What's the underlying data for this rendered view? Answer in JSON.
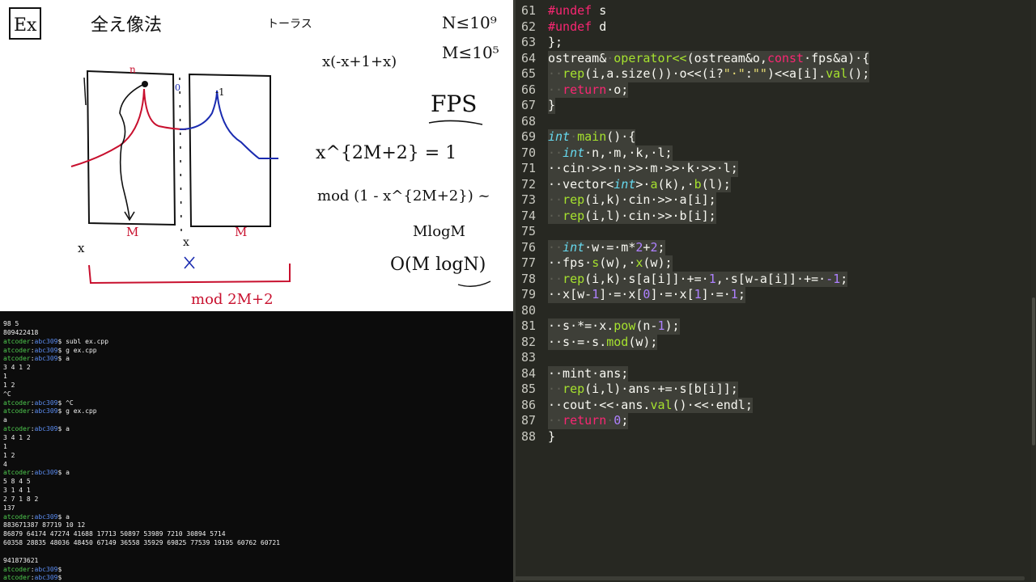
{
  "whiteboard": {
    "ex_label": "Ex",
    "title": "全え像法",
    "torus_note": "トーラス",
    "constraint_n": "N≤10⁹",
    "constraint_m": "M≤10⁵",
    "x_poly": "x(-x+1+x)",
    "fps": "FPS",
    "x_power": "x^{2M+2} = 1",
    "mod_expr": "mod (1 - x^{2M+2}) ~",
    "mlogm": "MlogM",
    "complexity": "O(M logN)",
    "top_mark": "n",
    "right_mark": "-1",
    "left_tick": "0",
    "x_label_left": "x",
    "m_label_left": "M",
    "x_label_mid": "x",
    "m_label_right": "M",
    "mod_bottom": "mod 2M+2"
  },
  "terminal": {
    "lines": [
      [
        [
          "98 5",
          ""
        ]
      ],
      [
        [
          "809422418",
          ""
        ]
      ],
      [
        [
          "atcoder",
          "u"
        ],
        [
          ":",
          ""
        ],
        [
          "abc309",
          "h"
        ],
        [
          "$ subl ex.cpp",
          ""
        ]
      ],
      [
        [
          "atcoder",
          "u"
        ],
        [
          ":",
          ""
        ],
        [
          "abc309",
          "h"
        ],
        [
          "$ g ex.cpp",
          ""
        ]
      ],
      [
        [
          "atcoder",
          "u"
        ],
        [
          ":",
          ""
        ],
        [
          "abc309",
          "h"
        ],
        [
          "$ a",
          ""
        ]
      ],
      [
        [
          "3 4 1 2",
          ""
        ]
      ],
      [
        [
          "1",
          ""
        ]
      ],
      [
        [
          "1 2",
          ""
        ]
      ],
      [
        [
          "^C",
          ""
        ]
      ],
      [
        [
          "atcoder",
          "u"
        ],
        [
          ":",
          ""
        ],
        [
          "abc309",
          "h"
        ],
        [
          "$ ^C",
          ""
        ]
      ],
      [
        [
          "atcoder",
          "u"
        ],
        [
          ":",
          ""
        ],
        [
          "abc309",
          "h"
        ],
        [
          "$ g ex.cpp",
          ""
        ]
      ],
      [
        [
          "a",
          ""
        ]
      ],
      [
        [
          "atcoder",
          "u"
        ],
        [
          ":",
          ""
        ],
        [
          "abc309",
          "h"
        ],
        [
          "$ a",
          ""
        ]
      ],
      [
        [
          "3 4 1 2",
          ""
        ]
      ],
      [
        [
          "1",
          ""
        ]
      ],
      [
        [
          "1 2",
          ""
        ]
      ],
      [
        [
          "4",
          ""
        ]
      ],
      [
        [
          "atcoder",
          "u"
        ],
        [
          ":",
          ""
        ],
        [
          "abc309",
          "h"
        ],
        [
          "$ a",
          ""
        ]
      ],
      [
        [
          "5 8 4 5",
          ""
        ]
      ],
      [
        [
          "3 1 4 1",
          ""
        ]
      ],
      [
        [
          "2 7 1 8 2",
          ""
        ]
      ],
      [
        [
          "137",
          ""
        ]
      ],
      [
        [
          "atcoder",
          "u"
        ],
        [
          ":",
          ""
        ],
        [
          "abc309",
          "h"
        ],
        [
          "$ a",
          ""
        ]
      ],
      [
        [
          "883671387 87719 10 12",
          ""
        ]
      ],
      [
        [
          "86879 64174 47274 41688 17713 50897 53989 7210 30894 5714",
          ""
        ]
      ],
      [
        [
          "60358 28835 48036 48450 67149 36558 35929 69825 77539 19195 60762 60721",
          ""
        ]
      ],
      [
        [
          "",
          ""
        ]
      ],
      [
        [
          "941873621",
          ""
        ]
      ],
      [
        [
          "atcoder",
          "u"
        ],
        [
          ":",
          ""
        ],
        [
          "abc309",
          "h"
        ],
        [
          "$",
          ""
        ]
      ],
      [
        [
          "atcoder",
          "u"
        ],
        [
          ":",
          ""
        ],
        [
          "abc309",
          "h"
        ],
        [
          "$",
          ""
        ]
      ]
    ]
  },
  "editor": {
    "lines": [
      {
        "n": "61",
        "sel": false,
        "t": [
          [
            "#undef",
            "kw"
          ],
          [
            " s",
            ""
          ]
        ]
      },
      {
        "n": "62",
        "sel": false,
        "t": [
          [
            "#undef",
            "kw"
          ],
          [
            " d",
            ""
          ]
        ]
      },
      {
        "n": "63",
        "sel": false,
        "t": [
          [
            "};",
            ""
          ]
        ]
      },
      {
        "n": "64",
        "sel": true,
        "t": [
          [
            "ostream&",
            ""
          ],
          [
            "·",
            "ws"
          ],
          [
            "operator<<",
            "fn"
          ],
          [
            "(ostream&o,",
            ""
          ],
          [
            "const",
            "kw"
          ],
          [
            "·fps&a)·{",
            ""
          ]
        ]
      },
      {
        "n": "65",
        "sel": true,
        "t": [
          [
            "··",
            "ws"
          ],
          [
            "rep",
            "fn"
          ],
          [
            "(i,a.size())·o<<(i?",
            ""
          ],
          [
            "\"·\"",
            "st"
          ],
          [
            ":",
            ""
          ],
          [
            "\"\"",
            "st"
          ],
          [
            ")<<a[i].",
            ""
          ],
          [
            "val",
            "fn"
          ],
          [
            "();",
            ""
          ]
        ]
      },
      {
        "n": "66",
        "sel": true,
        "t": [
          [
            "··",
            "ws"
          ],
          [
            "return",
            "kw"
          ],
          [
            "·o;",
            ""
          ]
        ]
      },
      {
        "n": "67",
        "sel": true,
        "t": [
          [
            "}",
            ""
          ]
        ]
      },
      {
        "n": "68",
        "sel": false,
        "t": [
          [
            "",
            ""
          ]
        ]
      },
      {
        "n": "69",
        "sel": true,
        "t": [
          [
            "int",
            "ty"
          ],
          [
            "·",
            "ws"
          ],
          [
            "main",
            "fn"
          ],
          [
            "()·{",
            ""
          ]
        ]
      },
      {
        "n": "70",
        "sel": true,
        "t": [
          [
            "··",
            "ws"
          ],
          [
            "int",
            "ty"
          ],
          [
            "·n,·m,·k,·l;",
            ""
          ]
        ]
      },
      {
        "n": "71",
        "sel": true,
        "t": [
          [
            "··cin·>>·n·>>·m·>>·k·>>·l;",
            ""
          ]
        ]
      },
      {
        "n": "72",
        "sel": true,
        "t": [
          [
            "··vector<",
            ""
          ],
          [
            "int",
            "ty"
          ],
          [
            ">·",
            ""
          ],
          [
            "a",
            "fn"
          ],
          [
            "(k),·",
            ""
          ],
          [
            "b",
            "fn"
          ],
          [
            "(l);",
            ""
          ]
        ]
      },
      {
        "n": "73",
        "sel": true,
        "t": [
          [
            "··",
            "ws"
          ],
          [
            "rep",
            "fn"
          ],
          [
            "(i,k)·cin·>>·a[i];",
            ""
          ]
        ]
      },
      {
        "n": "74",
        "sel": true,
        "t": [
          [
            "··",
            "ws"
          ],
          [
            "rep",
            "fn"
          ],
          [
            "(i,l)·cin·>>·b[i];",
            ""
          ]
        ]
      },
      {
        "n": "75",
        "sel": false,
        "t": [
          [
            "",
            ""
          ]
        ]
      },
      {
        "n": "76",
        "sel": true,
        "t": [
          [
            "··",
            "ws"
          ],
          [
            "int",
            "ty"
          ],
          [
            "·w·=·m*",
            ""
          ],
          [
            "2",
            "nm"
          ],
          [
            "+",
            ""
          ],
          [
            "2",
            "nm"
          ],
          [
            ";",
            ""
          ]
        ]
      },
      {
        "n": "77",
        "sel": true,
        "t": [
          [
            "··fps·",
            ""
          ],
          [
            "s",
            "fn"
          ],
          [
            "(w),·",
            ""
          ],
          [
            "x",
            "fn"
          ],
          [
            "(w);",
            ""
          ]
        ]
      },
      {
        "n": "78",
        "sel": true,
        "t": [
          [
            "··",
            "ws"
          ],
          [
            "rep",
            "fn"
          ],
          [
            "(i,k)·s[a[i]]·+=·",
            ""
          ],
          [
            "1",
            "nm"
          ],
          [
            ",·s[w-a[i]]·+=·",
            ""
          ],
          [
            "-1",
            "nm"
          ],
          [
            ";",
            ""
          ]
        ]
      },
      {
        "n": "79",
        "sel": true,
        "t": [
          [
            "··x[w-",
            ""
          ],
          [
            "1",
            "nm"
          ],
          [
            "]·=·x[",
            ""
          ],
          [
            "0",
            "nm"
          ],
          [
            "]·=·x[",
            ""
          ],
          [
            "1",
            "nm"
          ],
          [
            "]·=·",
            ""
          ],
          [
            "1",
            "nm"
          ],
          [
            ";",
            ""
          ]
        ]
      },
      {
        "n": "80",
        "sel": false,
        "t": [
          [
            "",
            ""
          ]
        ]
      },
      {
        "n": "81",
        "sel": true,
        "t": [
          [
            "··s·*=·x.",
            ""
          ],
          [
            "pow",
            "fn"
          ],
          [
            "(n-",
            ""
          ],
          [
            "1",
            "nm"
          ],
          [
            ");",
            ""
          ]
        ]
      },
      {
        "n": "82",
        "sel": true,
        "t": [
          [
            "··s·=·s.",
            ""
          ],
          [
            "mod",
            "fn"
          ],
          [
            "(w);",
            ""
          ]
        ]
      },
      {
        "n": "83",
        "sel": false,
        "t": [
          [
            "",
            ""
          ]
        ]
      },
      {
        "n": "84",
        "sel": true,
        "t": [
          [
            "··mint·ans;",
            ""
          ]
        ]
      },
      {
        "n": "85",
        "sel": true,
        "t": [
          [
            "··",
            "ws"
          ],
          [
            "rep",
            "fn"
          ],
          [
            "(i,l)·ans·+=·s[b[i]];",
            ""
          ]
        ]
      },
      {
        "n": "86",
        "sel": true,
        "t": [
          [
            "··cout·<<·ans.",
            ""
          ],
          [
            "val",
            "fn"
          ],
          [
            "()·<<·endl;",
            ""
          ]
        ]
      },
      {
        "n": "87",
        "sel": true,
        "t": [
          [
            "··",
            "ws"
          ],
          [
            "return",
            "kw"
          ],
          [
            "·",
            "ws"
          ],
          [
            "0",
            "nm"
          ],
          [
            ";",
            ""
          ]
        ]
      },
      {
        "n": "88",
        "sel": false,
        "t": [
          [
            "}",
            ""
          ]
        ]
      }
    ]
  },
  "colors": {
    "editor_bg": "#272822",
    "keyword": "#f92672",
    "type": "#66d9ef",
    "function": "#a6e22e",
    "number": "#ae81ff",
    "string": "#e6db74",
    "prompt_user": "#4ec94e",
    "prompt_host": "#5b8cf0",
    "ink_red": "#c8102e",
    "ink_blue": "#1a2bb0"
  }
}
